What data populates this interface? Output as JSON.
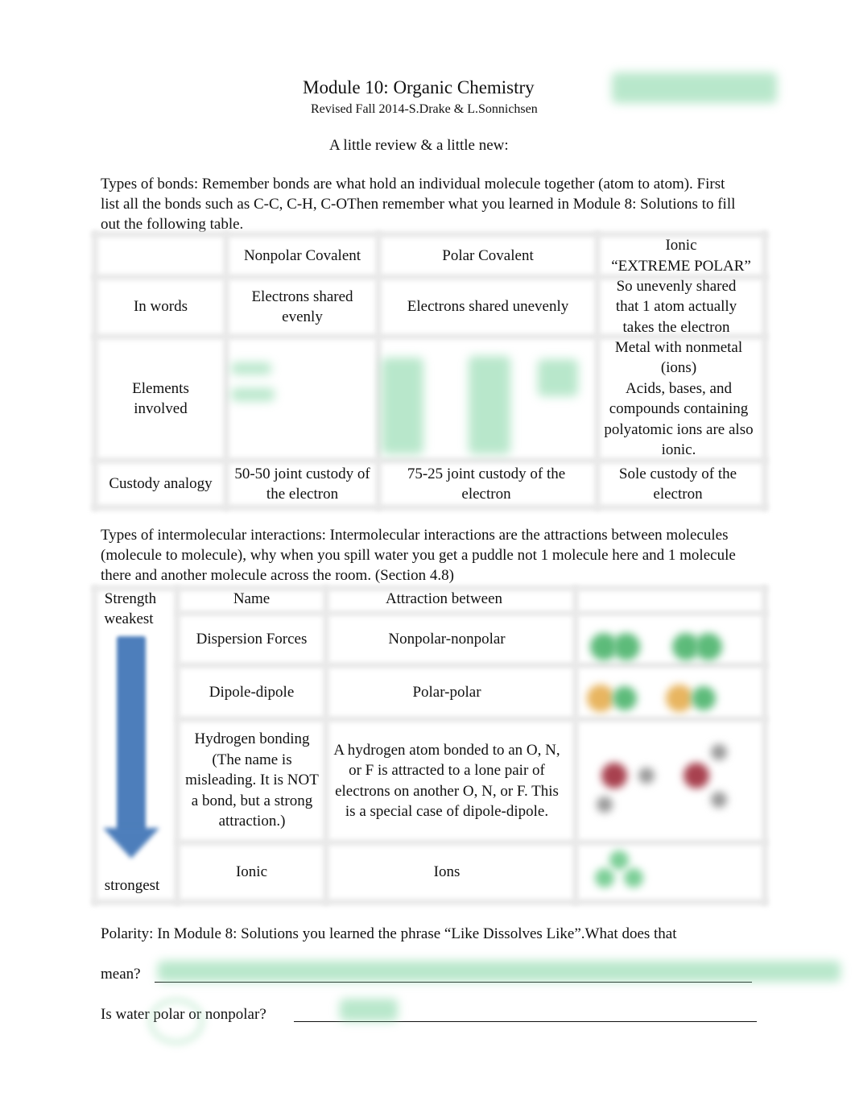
{
  "header": {
    "title": "Module 10:  Organic Chemistry",
    "subtitle": "Revised Fall 2014-S.Drake & L.Sonnichsen",
    "intro": "A little review & a little new:"
  },
  "bonds_section": {
    "paragraph": "Types of bonds:  Remember bonds are what hold an individual molecule together (atom to atom).  First list all the bonds such as C-C, C-H, C-OThen remember what you learned in Module 8:  Solutions to fill out the following table.",
    "table": {
      "columns": [
        "",
        "Nonpolar Covalent",
        "Polar Covalent",
        "Ionic\n“EXTREME POLAR”"
      ],
      "rows": [
        {
          "label": "In words",
          "nonpolar": "Electrons shared evenly",
          "polar": "Electrons shared unevenly",
          "ionic": "So unevenly shared that 1 atom actually takes the electron"
        },
        {
          "label": "Elements involved",
          "nonpolar": "",
          "polar": "",
          "ionic": "Metal with nonmetal (ions)\nAcids, bases, and compounds containing polyatomic ions are also ionic."
        },
        {
          "label": "Custody analogy",
          "nonpolar": "50-50 joint custody of the electron",
          "polar": "75-25 joint custody of the electron",
          "ionic": "Sole custody of the electron"
        }
      ]
    }
  },
  "imf_section": {
    "paragraph": "Types of intermolecular interactions:    Intermolecular interactions are the attractions between molecules (molecule to molecule), why when you spill water you get a puddle not 1 molecule here and 1 molecule there and another molecule across the room.     (Section 4.8)",
    "table": {
      "columns": [
        "Strength",
        "Name",
        "Attraction between",
        ""
      ],
      "strength_top": "weakest",
      "strength_bottom": "strongest",
      "rows": [
        {
          "name": "Dispersion Forces",
          "attraction": "Nonpolar-nonpolar",
          "image": "nonpolar-molecules-illustration"
        },
        {
          "name": "Dipole-dipole",
          "attraction": "Polar-polar",
          "image": "polar-molecules-illustration"
        },
        {
          "name": "Hydrogen bonding (The name is misleading.  It is NOT a bond, but a strong attraction.)",
          "attraction": "A hydrogen atom bonded to an O, N, or F is attracted to a lone pair of electrons on another O, N, or F.  This is a special case of dipole-dipole.",
          "image": "hydrogen-bond-illustration"
        },
        {
          "name": "Ionic",
          "attraction": "Ions",
          "image": "ionic-lattice-illustration"
        }
      ]
    }
  },
  "polarity_section": {
    "question1_part1": "Polarity:  In Module 8:  Solutions you learned the phrase “Like Dissolves Like”.What does that",
    "question1_part2": "mean?",
    "question2": "Is water polar or nonpolar?"
  },
  "colors": {
    "arrow": "#4d7ebb",
    "handwriting_blur": "#7fd4a1",
    "nonpolar_atom": "#5dbb7a",
    "polar_atom": "#e8b560",
    "oxygen_atom": "#a8414f",
    "grid": "#e9e9e9"
  }
}
